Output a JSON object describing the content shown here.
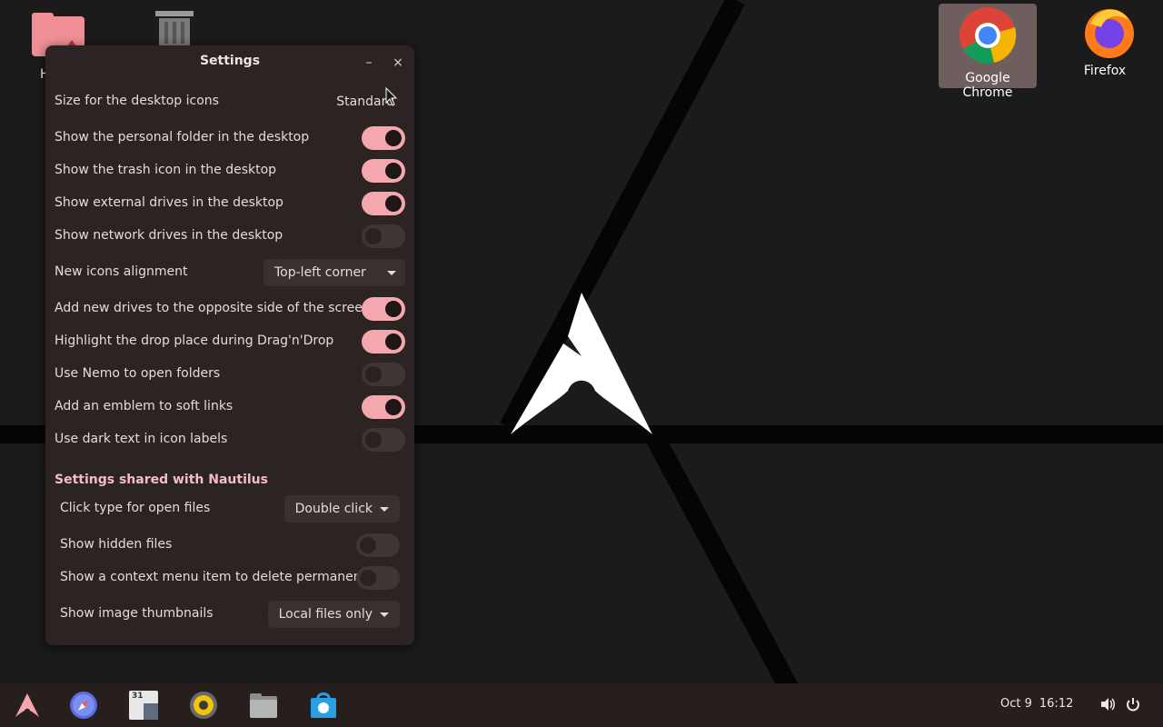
{
  "desktop": {
    "icons": [
      {
        "label": "H"
      },
      {
        "label": ""
      },
      {
        "label": "Google Chrome"
      },
      {
        "label": "Firefox"
      }
    ]
  },
  "window": {
    "title": "Settings",
    "minimize_symbol": "–",
    "close_symbol": "×",
    "icon_size": {
      "label": "Size for the desktop icons",
      "value": "Standard"
    },
    "toggles": [
      {
        "label": "Show the personal folder in the desktop",
        "on": true
      },
      {
        "label": "Show the trash icon in the desktop",
        "on": true
      },
      {
        "label": "Show external drives in the desktop",
        "on": true
      },
      {
        "label": "Show network drives in the desktop",
        "on": false
      }
    ],
    "alignment": {
      "label": "New icons alignment",
      "value": "Top-left corner"
    },
    "toggles2": [
      {
        "label": "Add new drives to the opposite side of the screen",
        "on": true
      },
      {
        "label": "Highlight the drop place during Drag'n'Drop",
        "on": true
      },
      {
        "label": "Use Nemo to open folders",
        "on": false
      },
      {
        "label": "Add an emblem to soft links",
        "on": true
      },
      {
        "label": "Use dark text in icon labels",
        "on": false
      }
    ],
    "nautilus": {
      "header": "Settings shared with Nautilus",
      "click_type": {
        "label": "Click type for open files",
        "value": "Double click"
      },
      "hidden_files": {
        "label": "Show hidden files",
        "on": false
      },
      "delete_permanently": {
        "label": "Show a context menu item to delete permanently",
        "on": false
      },
      "thumbnails": {
        "label": "Show image thumbnails",
        "value": "Local files only"
      }
    }
  },
  "taskbar": {
    "apps": [
      "arch-menu-icon",
      "web-browser-icon",
      "calendar-icon",
      "music-player-icon",
      "files-icon",
      "software-store-icon"
    ],
    "calendar_day": "31",
    "date": "Oct 9",
    "time": "16:12"
  },
  "colors": {
    "accent": "#f5a7ae",
    "window_bg": "#2c2323",
    "taskbar_bg": "#271e1e"
  }
}
